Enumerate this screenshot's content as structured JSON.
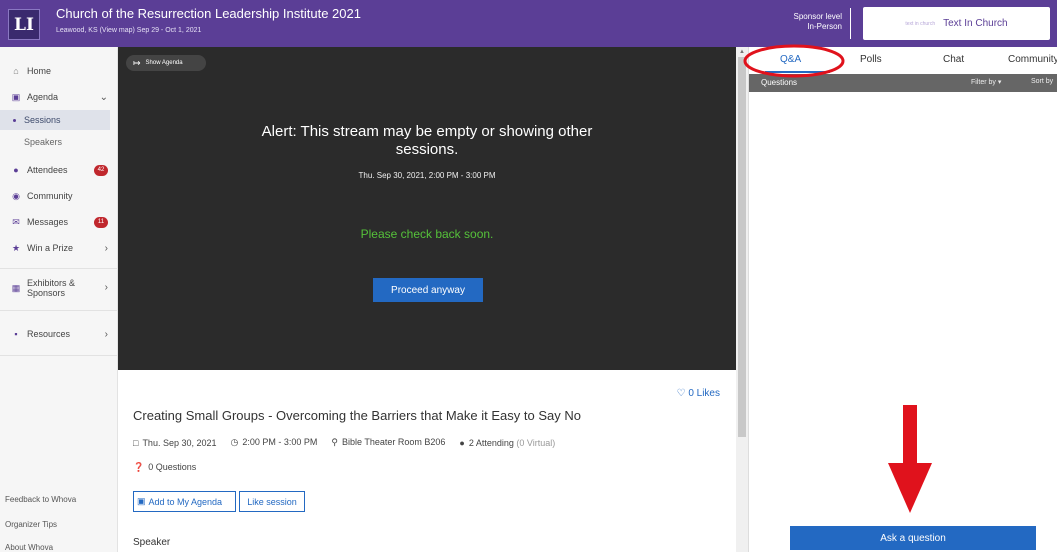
{
  "header": {
    "logo_text": "LI",
    "title": "Church of the Resurrection Leadership Institute 2021",
    "subtitle": "Leawood, KS (View map)  Sep 29 - Oct 1, 2021",
    "sponsor_level": "Sponsor level",
    "sponsor_type": "In-Person",
    "sponsor_mini": "text in church",
    "sponsor_name": "Text In Church"
  },
  "sidebar": {
    "home": "Home",
    "agenda": "Agenda",
    "sessions": "Sessions",
    "speakers": "Speakers",
    "attendees": "Attendees",
    "attendees_badge": "42",
    "community": "Community",
    "messages": "Messages",
    "messages_badge": "11",
    "win_prize": "Win a Prize",
    "exhibitors": "Exhibitors & Sponsors",
    "resources": "Resources",
    "feedback": "Feedback to Whova",
    "organizer_tips": "Organizer Tips",
    "about": "About Whova"
  },
  "video": {
    "show_agenda": "Show Agenda",
    "alert": "Alert: This stream may be empty or showing other sessions.",
    "time": "Thu. Sep 30, 2021, 2:00 PM - 3:00 PM",
    "check_back": "Please check back soon.",
    "proceed": "Proceed anyway"
  },
  "session": {
    "likes": "0 Likes",
    "title": "Creating Small Groups - Overcoming the Barriers that Make it Easy to Say No",
    "date": "Thu. Sep 30, 2021",
    "time": "2:00 PM - 3:00 PM",
    "room": "Bible Theater Room B206",
    "attending": "2 Attending",
    "virtual": "(0 Virtual)",
    "questions": "0 Questions",
    "add_agenda": "Add to My Agenda",
    "like_session": "Like session",
    "speaker_heading": "Speaker"
  },
  "panel": {
    "tabs": [
      "Q&A",
      "Polls",
      "Chat",
      "Community"
    ],
    "active_tab": "Q&A",
    "questions_label": "Questions",
    "filter_by": "Filter by ▾",
    "sort_by": "Sort by",
    "ask_button": "Ask a question"
  },
  "colors": {
    "header_purple": "#5b3e96",
    "accent_blue": "#2369c2",
    "alert_green": "#55c13a",
    "badge_red": "#c0272d",
    "annotation_red": "#e0121c"
  }
}
